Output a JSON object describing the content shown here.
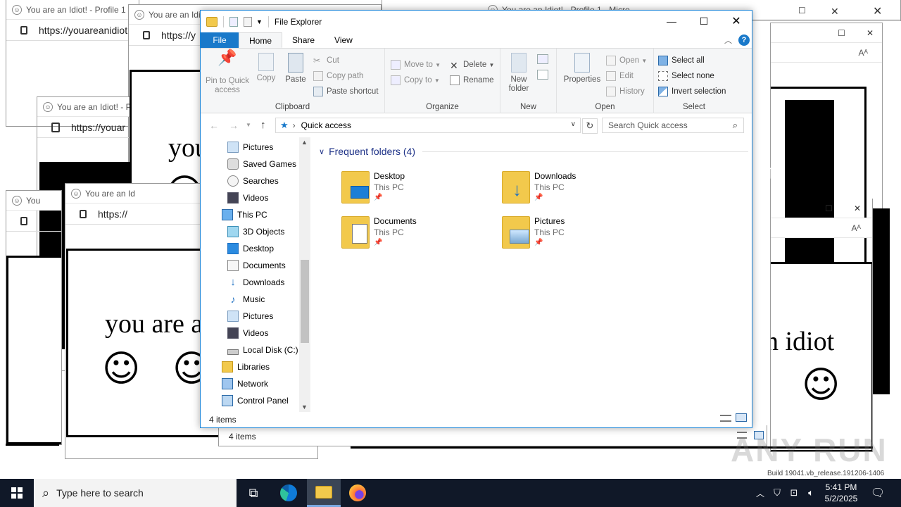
{
  "background_windows": {
    "tab_title": "You are an Idiot! - Profile 1",
    "tab_title_short": "You are an Idi",
    "tab_title_c": "You are an Idiot! - Pr",
    "tab_title_d": "You",
    "tab_title_e": "You are an Id",
    "tab_title_right": "You are an Idiot! - Profile 1 - Micro",
    "url": "https://youareanidiot",
    "url_short": "https://y",
    "url_c": "https://youar",
    "url_e": "https://",
    "idiot_text": "you",
    "idiot_text_long": "you are a",
    "idiot_right_a": "ot",
    "idiot_right_b": "t",
    "idiot_right_c": "n idiot",
    "smiley": "☺"
  },
  "explorer": {
    "title": "File Explorer",
    "tabs": {
      "file": "File",
      "home": "Home",
      "share": "Share",
      "view": "View"
    },
    "ribbon": {
      "clipboard": {
        "label": "Clipboard",
        "pin": "Pin to Quick access",
        "copy": "Copy",
        "paste": "Paste",
        "cut": "Cut",
        "copy_path": "Copy path",
        "paste_shortcut": "Paste shortcut"
      },
      "organize": {
        "label": "Organize",
        "move_to": "Move to",
        "copy_to": "Copy to",
        "delete": "Delete",
        "rename": "Rename"
      },
      "new": {
        "label": "New",
        "new_folder": "New folder"
      },
      "open": {
        "label": "Open",
        "properties": "Properties",
        "open": "Open",
        "edit": "Edit",
        "history": "History"
      },
      "select": {
        "label": "Select",
        "select_all": "Select all",
        "select_none": "Select none",
        "invert": "Invert selection"
      }
    },
    "address": {
      "location": "Quick access",
      "search_placeholder": "Search Quick access"
    },
    "tree": [
      "Pictures",
      "Saved Games",
      "Searches",
      "Videos",
      "This PC",
      "3D Objects",
      "Desktop",
      "Documents",
      "Downloads",
      "Music",
      "Pictures",
      "Videos",
      "Local Disk (C:)",
      "Libraries",
      "Network",
      "Control Panel"
    ],
    "section_title": "Frequent folders (4)",
    "folders": [
      {
        "name": "Desktop",
        "location": "This PC"
      },
      {
        "name": "Downloads",
        "location": "This PC"
      },
      {
        "name": "Documents",
        "location": "This PC"
      },
      {
        "name": "Pictures",
        "location": "This PC"
      }
    ],
    "status": "4 items"
  },
  "behind_explorer_status": "4 items",
  "taskbar": {
    "search_placeholder": "Type here to search",
    "time": "5:41 PM",
    "date": "5/2/2025"
  },
  "watermark": {
    "brand": "ANY RUN",
    "build": "Build 19041.vb_release.191206-1406"
  },
  "colors": {
    "accent": "#1979ca",
    "taskbar": "#101828"
  }
}
